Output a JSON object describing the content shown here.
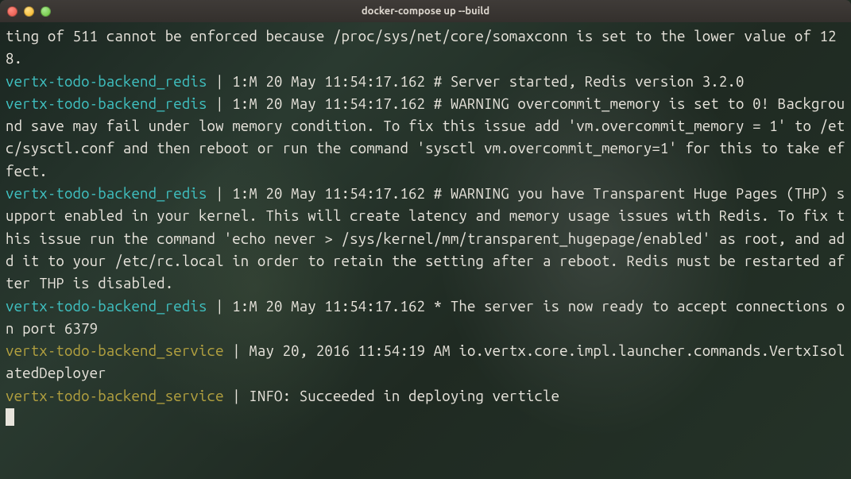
{
  "window_title": "docker-compose up --build",
  "prefix_redis": "vertx-todo-backend_redis",
  "prefix_service": "vertx-todo-backend_service",
  "pipe": " | ",
  "line0": "ting of 511 cannot be enforced because /proc/sys/net/core/somaxconn is set to the lower value of 128.",
  "line1": "1:M 20 May 11:54:17.162 # Server started, Redis version 3.2.0",
  "line2": "1:M 20 May 11:54:17.162 # WARNING overcommit_memory is set to 0! Background save may fail under low memory condition. To fix this issue add 'vm.overcommit_memory = 1' to /etc/sysctl.conf and then reboot or run the command 'sysctl vm.overcommit_memory=1' for this to take effect.",
  "line3": "1:M 20 May 11:54:17.162 # WARNING you have Transparent Huge Pages (THP) support enabled in your kernel. This will create latency and memory usage issues with Redis. To fix this issue run the command 'echo never > /sys/kernel/mm/transparent_hugepage/enabled' as root, and add it to your /etc/rc.local in order to retain the setting after a reboot. Redis must be restarted after THP is disabled.",
  "line4": "1:M 20 May 11:54:17.162 * The server is now ready to accept connections on port 6379",
  "line5": "May 20, 2016 11:54:19 AM io.vertx.core.impl.launcher.commands.VertxIsolatedDeployer",
  "line6": "INFO: Succeeded in deploying verticle"
}
